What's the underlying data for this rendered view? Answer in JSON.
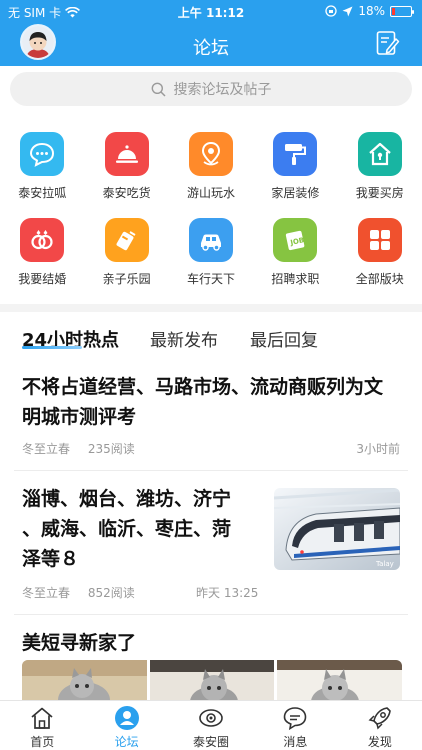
{
  "status_bar": {
    "carrier": "无 SIM 卡",
    "time": "上午 11:12",
    "battery": "18%",
    "battery_level": 0.18
  },
  "nav": {
    "title": "论坛"
  },
  "search": {
    "placeholder": "搜索论坛及帖子"
  },
  "categories": [
    {
      "label": "泰安拉呱",
      "icon": "chat-bubble-icon",
      "color": "#34b9f0"
    },
    {
      "label": "泰安吃货",
      "icon": "food-cloche-icon",
      "color": "#f24848"
    },
    {
      "label": "游山玩水",
      "icon": "map-pin-icon",
      "color": "#ff8a2a"
    },
    {
      "label": "家居装修",
      "icon": "paint-roller-icon",
      "color": "#3c7df0"
    },
    {
      "label": "我要买房",
      "icon": "house-icon",
      "color": "#18b5a2"
    },
    {
      "label": "我要结婚",
      "icon": "rings-icon",
      "color": "#f24848"
    },
    {
      "label": "亲子乐园",
      "icon": "toy-icon",
      "color": "#ffa21e"
    },
    {
      "label": "车行天下",
      "icon": "car-icon",
      "color": "#3c9ff0"
    },
    {
      "label": "招聘求职",
      "icon": "job-icon",
      "color": "#86c441"
    },
    {
      "label": "全部版块",
      "icon": "grid-icon",
      "color": "#f0512e"
    }
  ],
  "tabs": [
    {
      "label": "24小时热点"
    },
    {
      "label": "最新发布"
    },
    {
      "label": "最后回复"
    }
  ],
  "articles": [
    {
      "title_line1": "不将占道经营、马路市场、流动商贩列为文",
      "title_line2": "明城市测评考",
      "author": "冬至立春",
      "reads": "235阅读",
      "time": "3小时前"
    },
    {
      "title_line1": "淄博、烟台、潍坊、济宁",
      "title_line2": "、威海、临沂、枣庄、菏",
      "title_line3": "泽等８",
      "author": "冬至立春",
      "reads": "852阅读",
      "time": "昨天 13:25",
      "thumb_watermark": "Talay"
    }
  ],
  "section": {
    "title": "美短寻新家了"
  },
  "tabbar": [
    {
      "label": "首页",
      "icon": "home-icon"
    },
    {
      "label": "论坛",
      "icon": "forum-icon"
    },
    {
      "label": "泰安圈",
      "icon": "camera-circle-icon"
    },
    {
      "label": "消息",
      "icon": "message-icon"
    },
    {
      "label": "发现",
      "icon": "rocket-icon"
    }
  ]
}
